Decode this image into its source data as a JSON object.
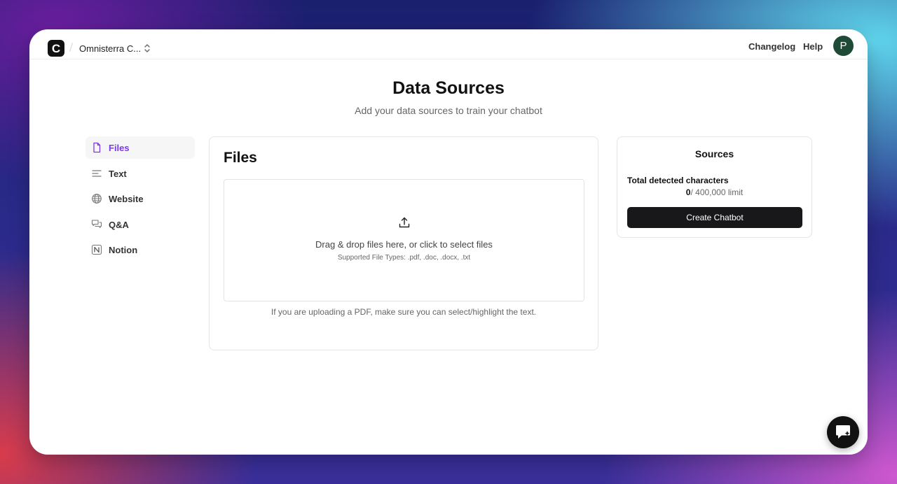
{
  "header": {
    "logo_letter": "C",
    "org_name": "Omnisterra C...",
    "links": {
      "changelog": "Changelog",
      "help": "Help"
    },
    "avatar_initial": "P"
  },
  "page": {
    "title": "Data Sources",
    "subtitle": "Add your data sources to train your chatbot"
  },
  "sidebar": {
    "items": [
      {
        "label": "Files",
        "icon": "file-icon",
        "active": true
      },
      {
        "label": "Text",
        "icon": "text-lines-icon",
        "active": false
      },
      {
        "label": "Website",
        "icon": "globe-icon",
        "active": false
      },
      {
        "label": "Q&A",
        "icon": "chat-bubbles-icon",
        "active": false
      },
      {
        "label": "Notion",
        "icon": "notion-icon",
        "active": false
      }
    ]
  },
  "files": {
    "title": "Files",
    "dropzone_text": "Drag & drop files here, or click to select files",
    "supported_types": "Supported File Types: .pdf, .doc, .docx, .txt",
    "pdf_note": "If you are uploading a PDF, make sure you can select/highlight the text."
  },
  "sources": {
    "title": "Sources",
    "total_label": "Total detected characters",
    "count": "0",
    "limit_text": "/ 400,000 limit",
    "create_button": "Create Chatbot"
  },
  "colors": {
    "accent": "#7c3aed",
    "button_bg": "#18181b",
    "avatar_bg": "#1e4a37"
  }
}
